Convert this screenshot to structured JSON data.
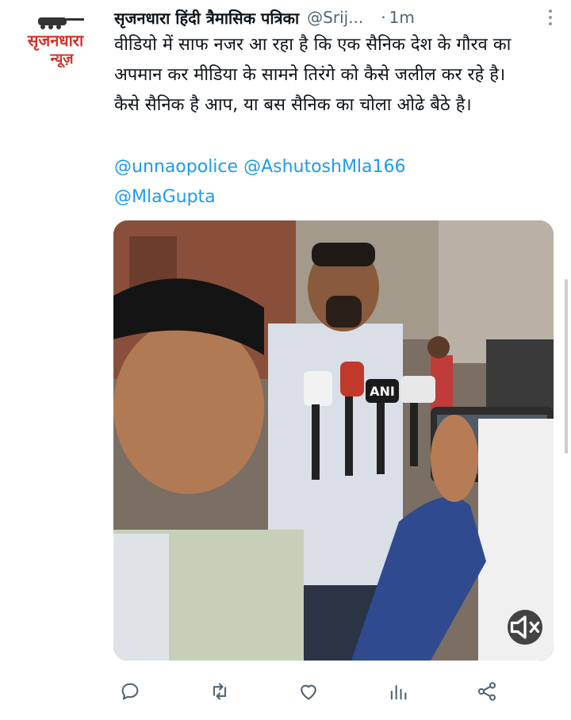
{
  "tweet": {
    "display_name": "सृजनधारा हिंदी त्रैमासिक पत्रिका",
    "handle": "@Srij...",
    "separator": "·",
    "time": "1m",
    "text_lines": [
      "वीडियो में साफ नजर आ रहा है कि एक सैनिक देश के गौरव का अपमान कर मीडिया के सामने तिरंगे को कैसे जलील कर रहे है।",
      "कैसे सैनिक है आप, या बस सैनिक का चोला ओढे बैठे है।"
    ],
    "mentions": [
      "@unnaopolice",
      "@AshutoshMla166",
      "@MlaGupta"
    ]
  },
  "avatar": {
    "logo_line1": "सृजनधारा",
    "logo_line2": "न्यूज़",
    "logo_color": "#d0312d"
  },
  "media": {
    "type": "video",
    "mic_labels": [
      "ANI"
    ],
    "mute_icon": "volume-muted-icon"
  },
  "actions": {
    "icons": [
      "reply-icon",
      "retweet-icon",
      "like-icon",
      "views-icon",
      "share-icon"
    ]
  },
  "colors": {
    "link": "#1d9bf0",
    "secondary_text": "#536471",
    "icon": "#536471"
  }
}
